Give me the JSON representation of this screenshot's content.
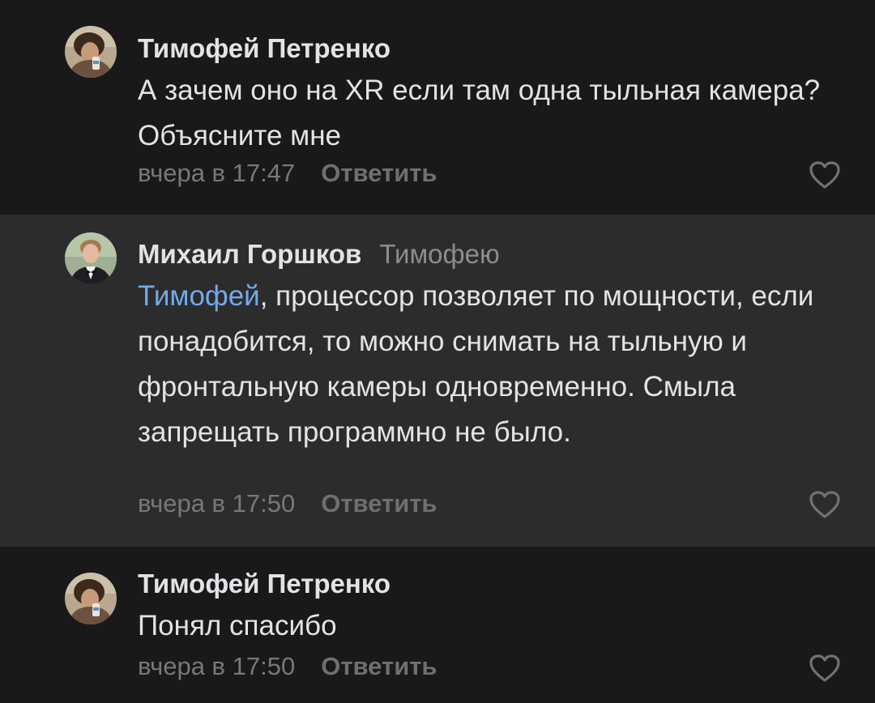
{
  "comments": [
    {
      "author": "Тимофей Петренко",
      "reply_to": "",
      "mention": "",
      "text": "А зачем оно на XR если там одна тыльная камера? Объясните мне",
      "time": "вчера в 17:47",
      "reply_label": "Ответить",
      "avatar_icon": "user-avatar-photo",
      "like_icon": "heart-outline-icon"
    },
    {
      "author": "Михаил Горшков",
      "reply_to": "Тимофею",
      "mention": "Тимофей",
      "text": ", процессор позволяет по мощности, если понадобится, то можно снимать на тыльную и фронтальную камеры одновременно. Смыла запрещать программно не было.",
      "time": "вчера в 17:50",
      "reply_label": "Ответить",
      "avatar_icon": "user-avatar-photo",
      "like_icon": "heart-outline-icon"
    },
    {
      "author": "Тимофей Петренко",
      "reply_to": "",
      "mention": "",
      "text": "Понял спасибо",
      "time": "вчера в 17:50",
      "reply_label": "Ответить",
      "avatar_icon": "user-avatar-photo",
      "like_icon": "heart-outline-icon"
    }
  ],
  "colors": {
    "background": "#19191a",
    "highlight_background": "#2c2c2d",
    "text": "#e1e3e6",
    "secondary": "#76787a",
    "mention": "#71aaeb"
  }
}
